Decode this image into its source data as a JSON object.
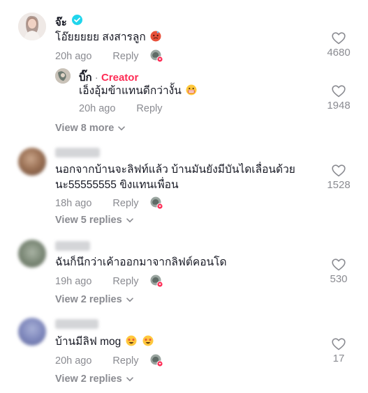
{
  "comments": [
    {
      "author": "จ๊ะ",
      "verified": true,
      "text": "โอ๊ยยยยย สงสารลูก",
      "emojis": [
        "hot-face-emoji"
      ],
      "time": "20h ago",
      "reply_label": "Reply",
      "likes": "4680",
      "replies": [
        {
          "author": "บิ๊ก",
          "separator": "·",
          "badge": "Creator",
          "text": "เอ็งอุ้มข้าแทนดีกว่างั้น",
          "emojis": [
            "grin-emoji"
          ],
          "time": "20h ago",
          "reply_label": "Reply",
          "likes": "1948"
        }
      ],
      "view_more": "View 8 more"
    },
    {
      "author": "",
      "text_line1": "นอกจากบ้านจะลิฟท์แล้ว บ้านมันยังมีบันไดเลื่อนด้วย",
      "text_line2": "นะ55555555 ขิงแทนเพื่อน",
      "time": "18h ago",
      "reply_label": "Reply",
      "likes": "1528",
      "view_more": "View 5 replies"
    },
    {
      "author": "",
      "text": "ฉันก็นึกว่าเค้าออกมาจากลิฟต์คอนโด",
      "time": "19h ago",
      "reply_label": "Reply",
      "likes": "530",
      "view_more": "View 2 replies"
    },
    {
      "author": "",
      "text": "บ้านมีลิฟ mog",
      "emojis": [
        "starstruck-emoji",
        "starstruck-emoji"
      ],
      "time": "20h ago",
      "reply_label": "Reply",
      "likes": "17",
      "view_more": "View 2 replies"
    }
  ],
  "colors": {
    "text": "#161823",
    "muted": "#8a8b91",
    "creator": "#fe2c55",
    "verified": "#20d5ec"
  }
}
